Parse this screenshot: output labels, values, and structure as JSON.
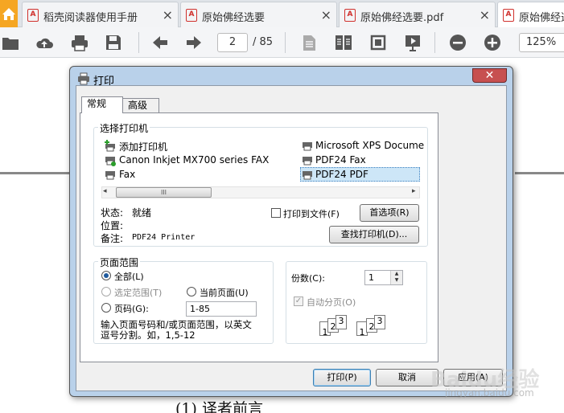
{
  "tabs": [
    {
      "title": "稻壳阅读器使用手册"
    },
    {
      "title": "原始佛经选要"
    },
    {
      "title": "原始佛经选要.pdf"
    },
    {
      "title": "原始佛经选"
    }
  ],
  "toolbar": {
    "page_current": "2",
    "page_total": "/ 85",
    "zoom": "125%"
  },
  "document": {
    "text": "(1) 译者前言"
  },
  "dialog": {
    "title": "打印",
    "close_glyph": "✕",
    "tabs": [
      {
        "label": "常规"
      },
      {
        "label": "高级"
      }
    ],
    "printer_group_label": "选择打印机",
    "printers": [
      {
        "name": "添加打印机"
      },
      {
        "name": "Canon Inkjet MX700 series FAX"
      },
      {
        "name": "Fax"
      },
      {
        "name": "Microsoft XPS Docume"
      },
      {
        "name": "PDF24 Fax"
      },
      {
        "name": "PDF24 PDF"
      }
    ],
    "scroll_thumb": "III",
    "status_label": "状态:",
    "status_value": "就绪",
    "location_label": "位置:",
    "comment_label": "备注:",
    "comment_value": "PDF24 Printer",
    "print_to_file": "打印到文件(F)",
    "preferences_button": "首选项(R)",
    "find_printer_button": "查找打印机(D)...",
    "range_group_label": "页面范围",
    "range_all": "全部(L)",
    "range_selection": "选定范围(T)",
    "range_current": "当前页面(U)",
    "range_pages": "页码(G):",
    "range_pages_value": "1-85",
    "range_help_line1": "输入页面号码和/或页面范围，以英文",
    "range_help_line2": "逗号分割。如，1,5-12",
    "copies_label": "份数(C):",
    "copies_value": "1",
    "collate_label": "自动分页(O)",
    "collate_digits": [
      "1",
      "2",
      "3",
      "1",
      "2",
      "3"
    ],
    "print_button": "打印(P)",
    "cancel_button": "取消",
    "apply_button": "应用(A)"
  },
  "watermark": {
    "text": "Baidu经验",
    "sub": "jingyan.baidu.com"
  },
  "colors": {
    "dialog_frame": "#b9d1ea",
    "close_red": "#c75050",
    "accent_tab": "#f5a623",
    "pdf_red": "#d0312d"
  }
}
